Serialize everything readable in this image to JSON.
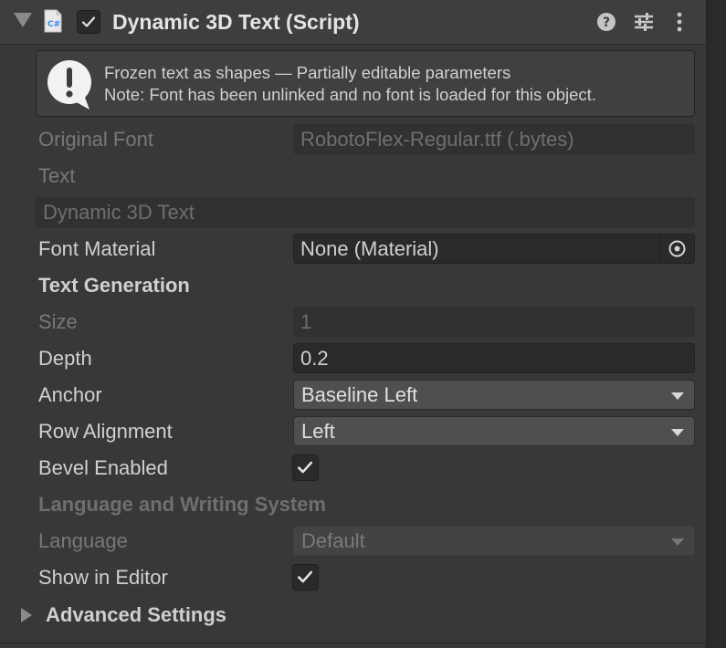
{
  "header": {
    "title": "Dynamic 3D Text (Script)",
    "enabled": true,
    "icons": [
      "foldout-arrow",
      "csharp-script-icon",
      "enabled-checkbox",
      "help-icon",
      "presets-icon",
      "more-menu-icon"
    ]
  },
  "info": {
    "line1": "Frozen text as shapes — Partially editable parameters",
    "line2": "Note: Font has been unlinked and no font is loaded for this object.",
    "icon": "info-icon"
  },
  "fields": {
    "original_font_label": "Original Font",
    "original_font_value": "RobotoFlex-Regular.ttf (.bytes)",
    "text_label": "Text",
    "text_value": "Dynamic 3D Text",
    "font_material_label": "Font Material",
    "font_material_value": "None (Material)",
    "text_generation_header": "Text Generation",
    "size_label": "Size",
    "size_value": "1",
    "depth_label": "Depth",
    "depth_value": "0.2",
    "anchor_label": "Anchor",
    "anchor_value": "Baseline Left",
    "row_alignment_label": "Row Alignment",
    "row_alignment_value": "Left",
    "bevel_label": "Bevel Enabled",
    "bevel_checked": true,
    "language_header": "Language and Writing System",
    "language_label": "Language",
    "language_value": "Default",
    "show_in_editor_label": "Show in Editor",
    "show_in_editor_checked": true,
    "advanced_settings_label": "Advanced Settings"
  },
  "colors": {
    "background": "#383838",
    "field": "#2a2a2a",
    "dropdown": "#4f4f4f",
    "text": "#d0d0d0",
    "disabled_text": "#787878"
  }
}
